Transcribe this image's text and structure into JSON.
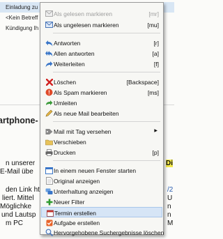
{
  "background": {
    "rows": [
      "Einladung zu",
      "<Kein Betreff",
      "Kündigung Ih"
    ],
    "heading": "artphone-",
    "body_lines": [
      "n unserer",
      "E-Mail übe",
      "",
      "den Link ht",
      "liert. Mittel",
      " Möglichke",
      "und Lautsp",
      "m PC"
    ],
    "right_edge": [
      "Di",
      "/2",
      "U",
      "n",
      "n",
      "M"
    ]
  },
  "menu": {
    "items": [
      {
        "label": "Als gelesen markieren",
        "shortcut": "[mr]",
        "icon": "mail-read-icon",
        "disabled": true
      },
      {
        "label": "Als ungelesen markieren",
        "shortcut": "[mu]",
        "icon": "mail-unread-icon",
        "disabled": false
      },
      {
        "label": "Antworten",
        "shortcut": "[r]",
        "icon": "reply-icon",
        "disabled": false
      },
      {
        "label": "Allen antworten",
        "shortcut": "[a]",
        "icon": "reply-all-icon",
        "disabled": false
      },
      {
        "label": "Weiterleiten",
        "shortcut": "[f]",
        "icon": "forward-icon",
        "disabled": false
      },
      {
        "label": "Löschen",
        "shortcut": "[Backspace]",
        "icon": "delete-icon",
        "disabled": false
      },
      {
        "label": "Als Spam markieren",
        "shortcut": "[ms]",
        "icon": "spam-icon",
        "disabled": false
      },
      {
        "label": "Umleiten",
        "shortcut": "",
        "icon": "redirect-icon",
        "disabled": false
      },
      {
        "label": "Als neue Mail bearbeiten",
        "shortcut": "",
        "icon": "edit-icon",
        "disabled": false
      },
      {
        "label": "Mail mit Tag versehen",
        "shortcut": "",
        "icon": "tag-icon",
        "disabled": false,
        "submenu": true
      },
      {
        "label": "Verschieben",
        "shortcut": "",
        "icon": "move-icon",
        "disabled": false
      },
      {
        "label": "Drucken",
        "shortcut": "[p]",
        "icon": "print-icon",
        "disabled": false
      },
      {
        "label": "In einem neuen Fenster starten",
        "shortcut": "",
        "icon": "new-window-icon",
        "disabled": false
      },
      {
        "label": "Original anzeigen",
        "shortcut": "",
        "icon": "show-original-icon",
        "disabled": false
      },
      {
        "label": "Unterhaltung anzeigen",
        "shortcut": "",
        "icon": "conversation-icon",
        "disabled": false
      },
      {
        "label": "Neuer Filter",
        "shortcut": "",
        "icon": "new-filter-icon",
        "disabled": false
      },
      {
        "label": "Termin erstellen",
        "shortcut": "",
        "icon": "calendar-icon",
        "disabled": false,
        "highlighted": true
      },
      {
        "label": "Aufgabe erstellen",
        "shortcut": "",
        "icon": "task-icon",
        "disabled": false
      },
      {
        "label": "Hervorgehobene Suchergebnisse löschen",
        "shortcut": "",
        "icon": "clear-highlight-icon",
        "disabled": false
      }
    ]
  },
  "colors": {
    "menu_bg": "#f7f7f4",
    "highlight_bg": "#d6e5f6",
    "disabled_text": "#9e9e9e"
  }
}
